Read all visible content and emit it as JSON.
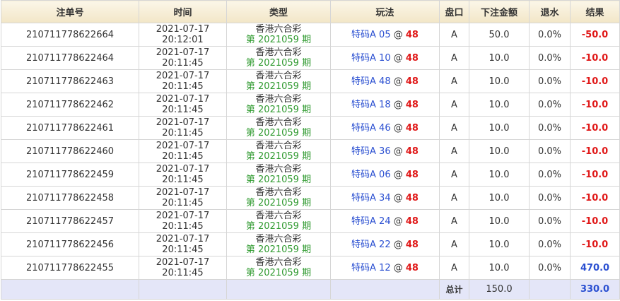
{
  "headers": {
    "order_no": "注单号",
    "time": "时间",
    "type": "类型",
    "play": "玩法",
    "market": "盘口",
    "amount": "下注金额",
    "rebate": "退水",
    "result": "结果"
  },
  "rows": [
    {
      "order_no": "210711778622664",
      "date": "2021-07-17",
      "time": "20:12:01",
      "lottery": "香港六合彩",
      "draw": "第 2021059 期",
      "play_code": "特码A 05",
      "odds": "48",
      "market": "A",
      "amount": "50.0",
      "rebate": "0.0%",
      "result": "-50.0"
    },
    {
      "order_no": "210711778622464",
      "date": "2021-07-17",
      "time": "20:11:45",
      "lottery": "香港六合彩",
      "draw": "第 2021059 期",
      "play_code": "特码A 10",
      "odds": "48",
      "market": "A",
      "amount": "10.0",
      "rebate": "0.0%",
      "result": "-10.0"
    },
    {
      "order_no": "210711778622463",
      "date": "2021-07-17",
      "time": "20:11:45",
      "lottery": "香港六合彩",
      "draw": "第 2021059 期",
      "play_code": "特码A 48",
      "odds": "48",
      "market": "A",
      "amount": "10.0",
      "rebate": "0.0%",
      "result": "-10.0"
    },
    {
      "order_no": "210711778622462",
      "date": "2021-07-17",
      "time": "20:11:45",
      "lottery": "香港六合彩",
      "draw": "第 2021059 期",
      "play_code": "特码A 18",
      "odds": "48",
      "market": "A",
      "amount": "10.0",
      "rebate": "0.0%",
      "result": "-10.0"
    },
    {
      "order_no": "210711778622461",
      "date": "2021-07-17",
      "time": "20:11:45",
      "lottery": "香港六合彩",
      "draw": "第 2021059 期",
      "play_code": "特码A 46",
      "odds": "48",
      "market": "A",
      "amount": "10.0",
      "rebate": "0.0%",
      "result": "-10.0"
    },
    {
      "order_no": "210711778622460",
      "date": "2021-07-17",
      "time": "20:11:45",
      "lottery": "香港六合彩",
      "draw": "第 2021059 期",
      "play_code": "特码A 36",
      "odds": "48",
      "market": "A",
      "amount": "10.0",
      "rebate": "0.0%",
      "result": "-10.0"
    },
    {
      "order_no": "210711778622459",
      "date": "2021-07-17",
      "time": "20:11:45",
      "lottery": "香港六合彩",
      "draw": "第 2021059 期",
      "play_code": "特码A 06",
      "odds": "48",
      "market": "A",
      "amount": "10.0",
      "rebate": "0.0%",
      "result": "-10.0"
    },
    {
      "order_no": "210711778622458",
      "date": "2021-07-17",
      "time": "20:11:45",
      "lottery": "香港六合彩",
      "draw": "第 2021059 期",
      "play_code": "特码A 34",
      "odds": "48",
      "market": "A",
      "amount": "10.0",
      "rebate": "0.0%",
      "result": "-10.0"
    },
    {
      "order_no": "210711778622457",
      "date": "2021-07-17",
      "time": "20:11:45",
      "lottery": "香港六合彩",
      "draw": "第 2021059 期",
      "play_code": "特码A 24",
      "odds": "48",
      "market": "A",
      "amount": "10.0",
      "rebate": "0.0%",
      "result": "-10.0"
    },
    {
      "order_no": "210711778622456",
      "date": "2021-07-17",
      "time": "20:11:45",
      "lottery": "香港六合彩",
      "draw": "第 2021059 期",
      "play_code": "特码A 22",
      "odds": "48",
      "market": "A",
      "amount": "10.0",
      "rebate": "0.0%",
      "result": "-10.0"
    },
    {
      "order_no": "210711778622455",
      "date": "2021-07-17",
      "time": "20:11:45",
      "lottery": "香港六合彩",
      "draw": "第 2021059 期",
      "play_code": "特码A 12",
      "odds": "48",
      "market": "A",
      "amount": "10.0",
      "rebate": "0.0%",
      "result": "470.0"
    }
  ],
  "total": {
    "label": "总计",
    "amount": "150.0",
    "result": "330.0"
  },
  "colors": {
    "header_bg": "#f2e6c7",
    "total_bg": "#e4e6f8",
    "draw_green": "#2f9a2f",
    "play_blue": "#2a4fd1",
    "odds_red": "#e01818",
    "win_blue": "#2a4fd1",
    "loss_red": "#e01818"
  }
}
